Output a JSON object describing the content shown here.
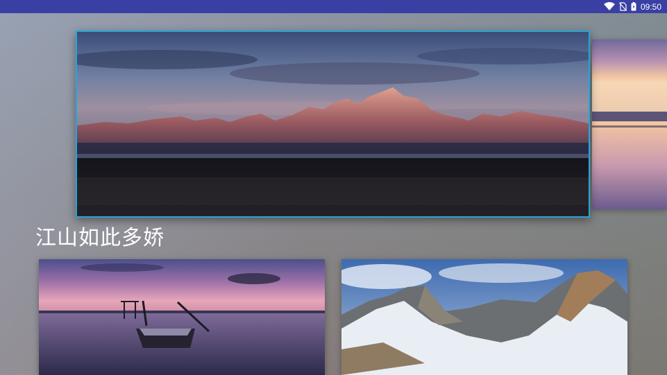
{
  "status_bar": {
    "time": "09:50",
    "icons": [
      "wifi-icon",
      "no-sim-icon",
      "battery-icon"
    ]
  },
  "featured": {
    "image": "mountain-range-at-dusk-image"
  },
  "side_preview": {
    "image": "sunset-lake-image"
  },
  "section": {
    "title": "江山如此多娇"
  },
  "cards": [
    {
      "image": "lake-boat-at-dusk-image"
    },
    {
      "image": "snowy-mountains-image"
    }
  ],
  "colors": {
    "status_bar": "#3a3fa3",
    "focus_border": "#27a6d6",
    "title_text": "#ffffff"
  }
}
